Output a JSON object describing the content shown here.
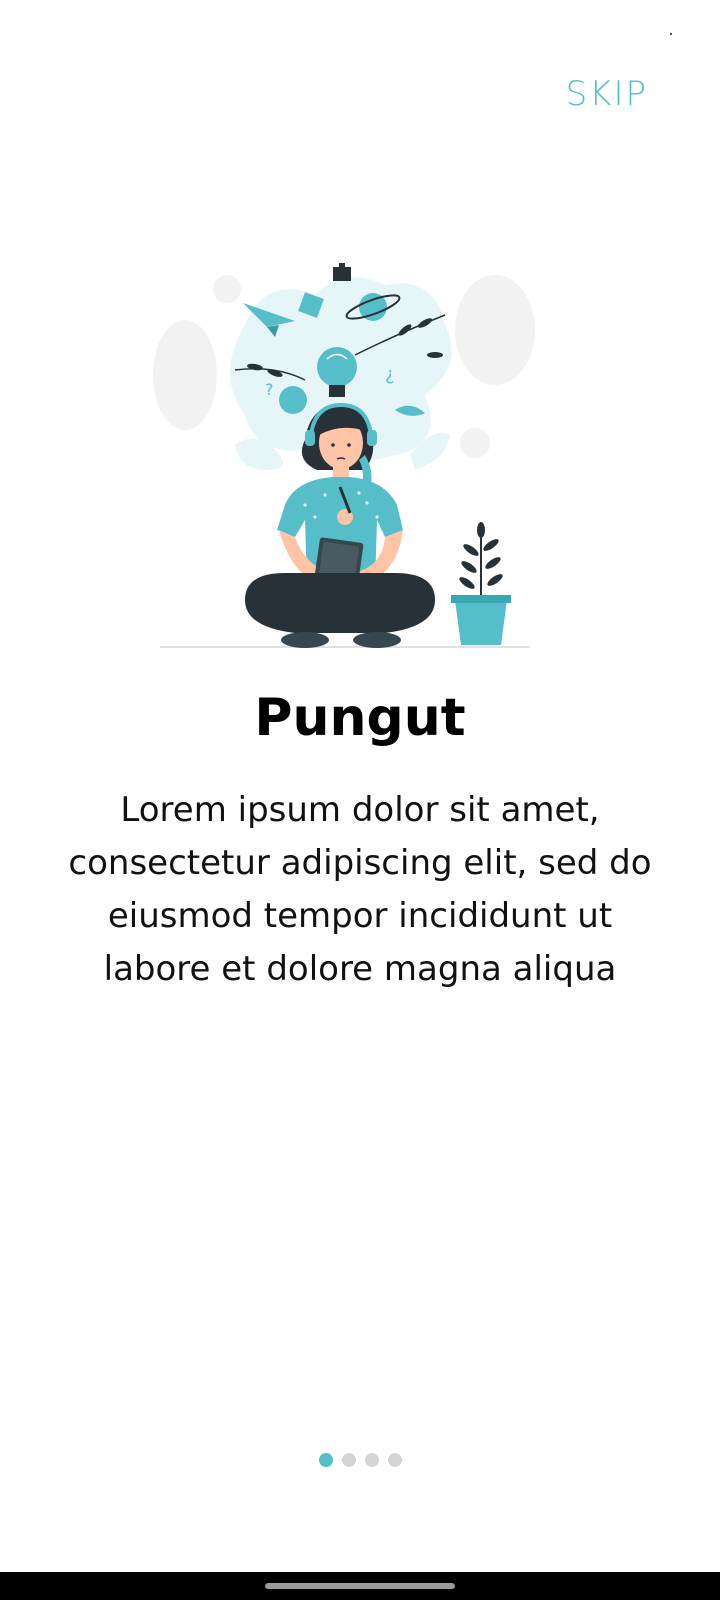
{
  "header": {
    "skip_label": "SKIP"
  },
  "illustration": {
    "icon": "woman-thinking-illustration"
  },
  "content": {
    "title": "Pungut",
    "description": "Lorem ipsum dolor sit amet, consectetur adipiscing elit, sed do eiusmod tempor incididunt ut labore et dolore magna aliqua"
  },
  "pager": {
    "total_pages": 4,
    "current_page": 1
  },
  "colors": {
    "accent": "#55bec9",
    "dot_inactive": "#d4d4d4",
    "dark": "#263238"
  }
}
